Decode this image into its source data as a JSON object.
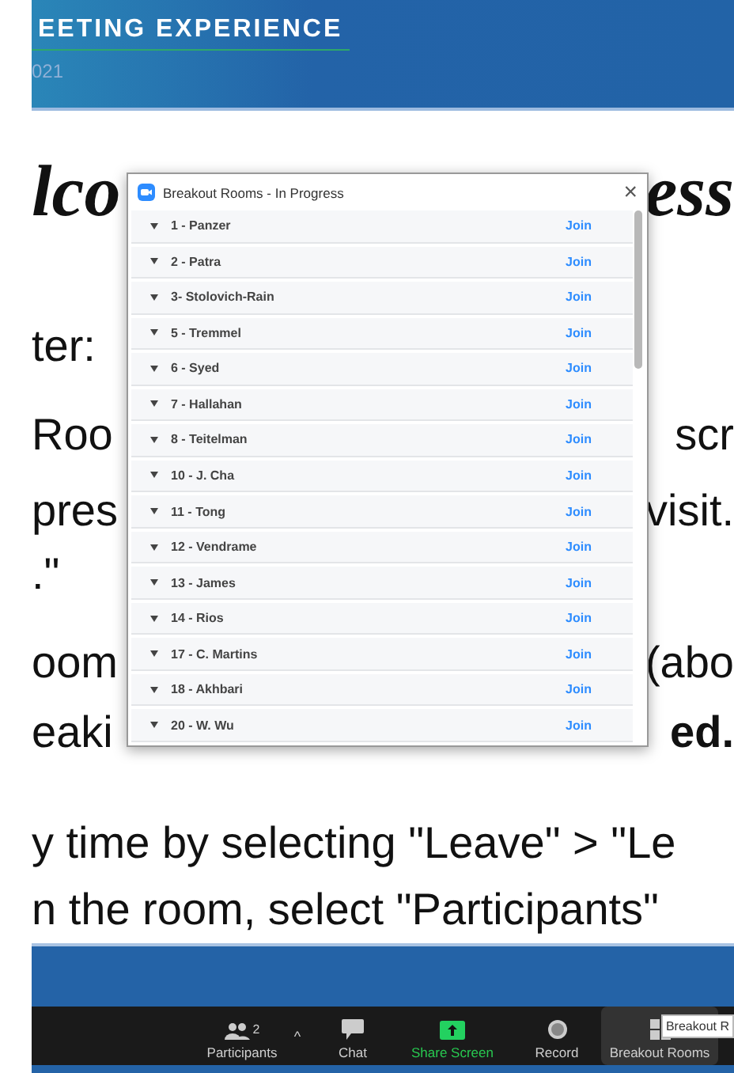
{
  "banner": {
    "title": "EETING EXPERIENCE",
    "subtitle": "021"
  },
  "slide": {
    "lines": [
      {
        "kind": "title",
        "left": "lco",
        "right": "ess"
      },
      {
        "kind": "body",
        "left": "ter:"
      },
      {
        "kind": "body",
        "left": "Roo",
        "right": "scr"
      },
      {
        "kind": "body",
        "left": "pres",
        "right": "visit."
      },
      {
        "kind": "body",
        "left": ".\""
      },
      {
        "kind": "body",
        "left": "oom",
        "right": "(abo"
      },
      {
        "kind": "body",
        "left": "eaki",
        "right": "ed.",
        "right_bold": true
      },
      {
        "kind": "full",
        "left": "y time by selecting \"Leave\" > \"Le"
      },
      {
        "kind": "full",
        "left": "n the room, select \"Participants\""
      }
    ]
  },
  "dialog": {
    "title": "Breakout Rooms - In Progress",
    "close": "×",
    "rooms": [
      {
        "name": "1 - Panzer",
        "action": "Join"
      },
      {
        "name": "2 - Patra",
        "action": "Join"
      },
      {
        "name": "3- Stolovich-Rain",
        "action": "Join"
      },
      {
        "name": "5 - Tremmel",
        "action": "Join"
      },
      {
        "name": "6 - Syed",
        "action": "Join"
      },
      {
        "name": "7 - Hallahan",
        "action": "Join"
      },
      {
        "name": "8 - Teitelman",
        "action": "Join"
      },
      {
        "name": "10 - J. Cha",
        "action": "Join"
      },
      {
        "name": "11 - Tong",
        "action": "Join"
      },
      {
        "name": "12 - Vendrame",
        "action": "Join"
      },
      {
        "name": "13 - James",
        "action": "Join"
      },
      {
        "name": "14 - Rios",
        "action": "Join"
      },
      {
        "name": "17 - C. Martins",
        "action": "Join"
      },
      {
        "name": "18 - Akhbari",
        "action": "Join"
      },
      {
        "name": "20 - W. Wu",
        "action": "Join"
      }
    ]
  },
  "toolbar": {
    "items": [
      {
        "kind": "participants",
        "label": "Participants",
        "count": "2",
        "caret": "^",
        "selected": false
      },
      {
        "kind": "chat",
        "label": "Chat",
        "selected": false
      },
      {
        "kind": "share",
        "label": "Share Screen",
        "selected": false
      },
      {
        "kind": "record",
        "label": "Record",
        "selected": false
      },
      {
        "kind": "breakout",
        "label": "Breakout Rooms",
        "selected": true
      }
    ],
    "tooltip": "Breakout R"
  }
}
